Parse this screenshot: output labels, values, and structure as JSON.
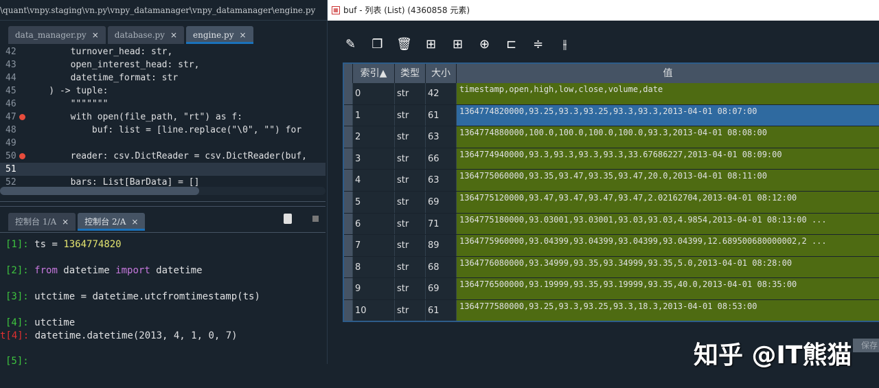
{
  "editor": {
    "path": "\\quant\\vnpy.staging\\vn.py\\vnpy_datamanager\\vnpy_datamanager\\engine.py",
    "tabs": [
      {
        "label": "data_manager.py"
      },
      {
        "label": "database.py"
      },
      {
        "label": "engine.py"
      }
    ],
    "close": "×",
    "lines": [
      {
        "n": "42",
        "code": "        turnover_head: str,"
      },
      {
        "n": "43",
        "code": "        open_interest_head: str,"
      },
      {
        "n": "44",
        "code": "        datetime_format: str"
      },
      {
        "n": "45",
        "code": "    ) -> tuple:"
      },
      {
        "n": "46",
        "code": "        \"\"\"\"\"\"\""
      },
      {
        "n": "47",
        "code": "        with open(file_path, \"rt\") as f:"
      },
      {
        "n": "48",
        "code": "            buf: list = [line.replace(\"\\0\", \"\") for"
      },
      {
        "n": "49",
        "code": ""
      },
      {
        "n": "50",
        "code": "        reader: csv.DictReader = csv.DictReader(buf,"
      },
      {
        "n": "51",
        "code": ""
      },
      {
        "n": "52",
        "code": "        bars: List[BarData] = []"
      }
    ]
  },
  "console": {
    "tabs": [
      {
        "label": "控制台 1/A"
      },
      {
        "label": "控制台 2/A"
      }
    ],
    "lines": [
      {
        "prompt": "[1]:",
        "code": "ts = ",
        "num": "1364774820"
      },
      {
        "prompt": "[2]:",
        "kw1": "from",
        "mid": " datetime ",
        "kw2": "import",
        "end": " datetime"
      },
      {
        "prompt": "[3]:",
        "code": "utctime = datetime.utcfromtimestamp(ts)"
      },
      {
        "prompt": "[4]:",
        "code": "utctime"
      },
      {
        "prompt": "t[4]:",
        "code": "datetime.datetime(2013, 4, 1, 0, 7)"
      },
      {
        "prompt": "[5]:",
        "code": ""
      }
    ]
  },
  "dialog": {
    "title": "buf - 列表 (List) (4360858 元素)",
    "headers": {
      "index": "索引▲",
      "type": "类型",
      "size": "大小",
      "value": "值"
    },
    "rows": [
      {
        "i": "0",
        "t": "str",
        "s": "42",
        "v": "timestamp,open,high,low,close,volume,date"
      },
      {
        "i": "1",
        "t": "str",
        "s": "61",
        "v": "1364774820000,93.25,93.3,93.25,93.3,93.3,2013-04-01 08:07:00"
      },
      {
        "i": "2",
        "t": "str",
        "s": "63",
        "v": "1364774880000,100.0,100.0,100.0,100.0,93.3,2013-04-01 08:08:00"
      },
      {
        "i": "3",
        "t": "str",
        "s": "66",
        "v": "1364774940000,93.3,93.3,93.3,93.3,33.67686227,2013-04-01 08:09:00"
      },
      {
        "i": "4",
        "t": "str",
        "s": "63",
        "v": "1364775060000,93.35,93.47,93.35,93.47,20.0,2013-04-01 08:11:00"
      },
      {
        "i": "5",
        "t": "str",
        "s": "69",
        "v": "1364775120000,93.47,93.47,93.47,93.47,2.02162704,2013-04-01 08:12:00"
      },
      {
        "i": "6",
        "t": "str",
        "s": "71",
        "v": "1364775180000,93.03001,93.03001,93.03,93.03,4.9854,2013-04-01 08:13:00 ..."
      },
      {
        "i": "7",
        "t": "str",
        "s": "89",
        "v": "1364775960000,93.04399,93.04399,93.04399,93.04399,12.689500680000002,2 ..."
      },
      {
        "i": "8",
        "t": "str",
        "s": "68",
        "v": "1364776080000,93.34999,93.35,93.34999,93.35,5.0,2013-04-01 08:28:00"
      },
      {
        "i": "9",
        "t": "str",
        "s": "69",
        "v": "1364776500000,93.19999,93.35,93.19999,93.35,40.0,2013-04-01 08:35:00"
      },
      {
        "i": "10",
        "t": "str",
        "s": "61",
        "v": "1364777580000,93.25,93.3,93.25,93.3,18.3,2013-04-01 08:53:00"
      }
    ],
    "save": "保存"
  },
  "watermark": "知乎 @IT熊猫"
}
